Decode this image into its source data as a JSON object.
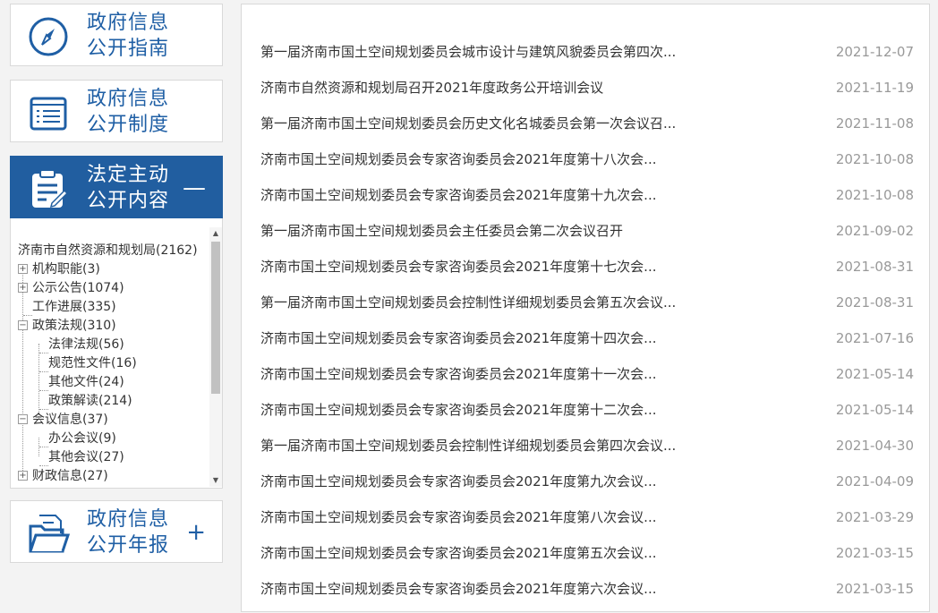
{
  "nav": {
    "guide": {
      "line1": "政府信息",
      "line2": "公开指南"
    },
    "system": {
      "line1": "政府信息",
      "line2": "公开制度"
    },
    "content": {
      "line1": "法定主动",
      "line2": "公开内容",
      "toggle": "—"
    },
    "annual": {
      "line1": "政府信息",
      "line2": "公开年报",
      "toggle": "+"
    }
  },
  "tree": {
    "root": "济南市自然资源和规划局(2162)",
    "items": [
      {
        "label": "机构职能(3)",
        "expander": "+"
      },
      {
        "label": "公示公告(1074)",
        "expander": "+"
      },
      {
        "label": "工作进展(335)"
      },
      {
        "label": "政策法规(310)",
        "expander": "−"
      },
      {
        "label": "法律法规(56)"
      },
      {
        "label": "规范性文件(16)"
      },
      {
        "label": "其他文件(24)"
      },
      {
        "label": "政策解读(214)"
      },
      {
        "label": "会议信息(37)",
        "expander": "−"
      },
      {
        "label": "办公会议(9)"
      },
      {
        "label": "其他会议(27)"
      },
      {
        "label": "财政信息(27)",
        "expander": "+"
      }
    ]
  },
  "scroll": {
    "up": "▲",
    "down": "▼"
  },
  "news": [
    {
      "title": "第一届济南市国土空间规划委员会城市设计与建筑风貌委员会第四次...",
      "date": "2021-12-07"
    },
    {
      "title": "济南市自然资源和规划局召开2021年度政务公开培训会议",
      "date": "2021-11-19"
    },
    {
      "title": "第一届济南市国土空间规划委员会历史文化名城委员会第一次会议召...",
      "date": "2021-11-08"
    },
    {
      "title": "济南市国土空间规划委员会专家咨询委员会2021年度第十八次会...",
      "date": "2021-10-08"
    },
    {
      "title": "济南市国土空间规划委员会专家咨询委员会2021年度第十九次会...",
      "date": "2021-10-08"
    },
    {
      "title": "第一届济南市国土空间规划委员会主任委员会第二次会议召开",
      "date": "2021-09-02"
    },
    {
      "title": "济南市国土空间规划委员会专家咨询委员会2021年度第十七次会...",
      "date": "2021-08-31"
    },
    {
      "title": "第一届济南市国土空间规划委员会控制性详细规划委员会第五次会议...",
      "date": "2021-08-31"
    },
    {
      "title": "济南市国土空间规划委员会专家咨询委员会2021年度第十四次会...",
      "date": "2021-07-16"
    },
    {
      "title": "济南市国土空间规划委员会专家咨询委员会2021年度第十一次会...",
      "date": "2021-05-14"
    },
    {
      "title": "济南市国土空间规划委员会专家咨询委员会2021年度第十二次会...",
      "date": "2021-05-14"
    },
    {
      "title": "第一届济南市国土空间规划委员会控制性详细规划委员会第四次会议...",
      "date": "2021-04-30"
    },
    {
      "title": "济南市国土空间规划委员会专家咨询委员会2021年度第九次会议...",
      "date": "2021-04-09"
    },
    {
      "title": "济南市国土空间规划委员会专家咨询委员会2021年度第八次会议...",
      "date": "2021-03-29"
    },
    {
      "title": "济南市国土空间规划委员会专家咨询委员会2021年度第五次会议...",
      "date": "2021-03-15"
    },
    {
      "title": "济南市国土空间规划委员会专家咨询委员会2021年度第六次会议...",
      "date": "2021-03-15"
    }
  ]
}
